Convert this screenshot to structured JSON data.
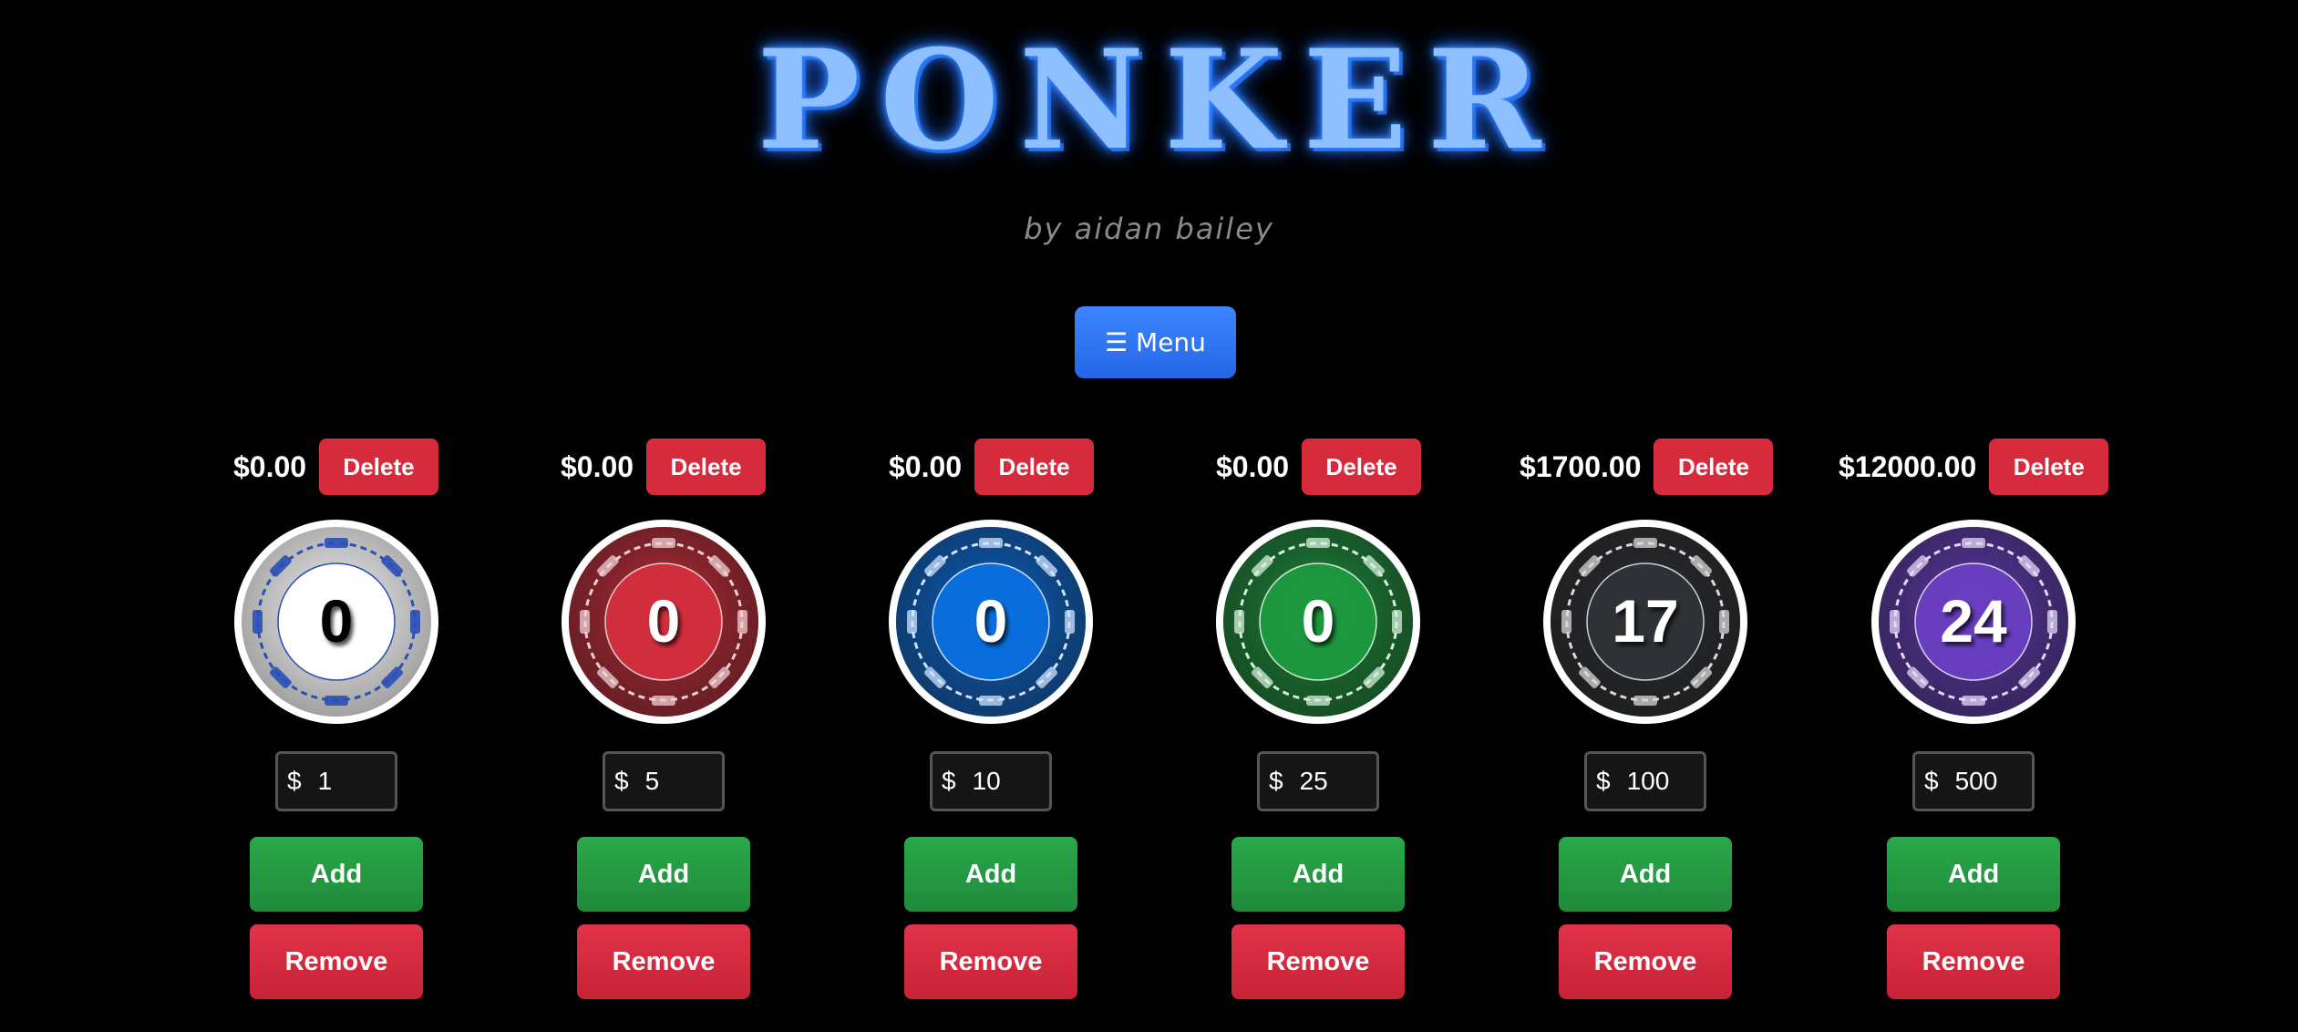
{
  "app": {
    "title": "PONKER",
    "subtitle": "by aidan bailey",
    "menu_label": "☰ Menu"
  },
  "chips": [
    {
      "value": "$0.00",
      "delete_label": "Delete",
      "count": "0",
      "currency": "$",
      "denomination": "1",
      "add_label": "Add",
      "remove_label": "Remove",
      "color": "#f2f2f2",
      "accent": "#2a4fb5",
      "text_color": "#000000"
    },
    {
      "value": "$0.00",
      "delete_label": "Delete",
      "count": "0",
      "currency": "$",
      "denomination": "5",
      "add_label": "Add",
      "remove_label": "Remove",
      "color": "#d42f3e",
      "accent": "#f0d0d4",
      "text_color": "#ffffff"
    },
    {
      "value": "$0.00",
      "delete_label": "Delete",
      "count": "0",
      "currency": "$",
      "denomination": "10",
      "add_label": "Add",
      "remove_label": "Remove",
      "color": "#0a6fe0",
      "accent": "#cfe3ff",
      "text_color": "#ffffff"
    },
    {
      "value": "$0.00",
      "delete_label": "Delete",
      "count": "0",
      "currency": "$",
      "denomination": "25",
      "add_label": "Add",
      "remove_label": "Remove",
      "color": "#1e9a3f",
      "accent": "#d4f0dc",
      "text_color": "#ffffff"
    },
    {
      "value": "$1700.00",
      "delete_label": "Delete",
      "count": "17",
      "currency": "$",
      "denomination": "100",
      "add_label": "Add",
      "remove_label": "Remove",
      "color": "#2f3236",
      "accent": "#d8d8d8",
      "text_color": "#ffffff"
    },
    {
      "value": "$12000.00",
      "delete_label": "Delete",
      "count": "24",
      "currency": "$",
      "denomination": "500",
      "add_label": "Add",
      "remove_label": "Remove",
      "color": "#6a3fc2",
      "accent": "#e3d8f7",
      "text_color": "#ffffff"
    }
  ]
}
